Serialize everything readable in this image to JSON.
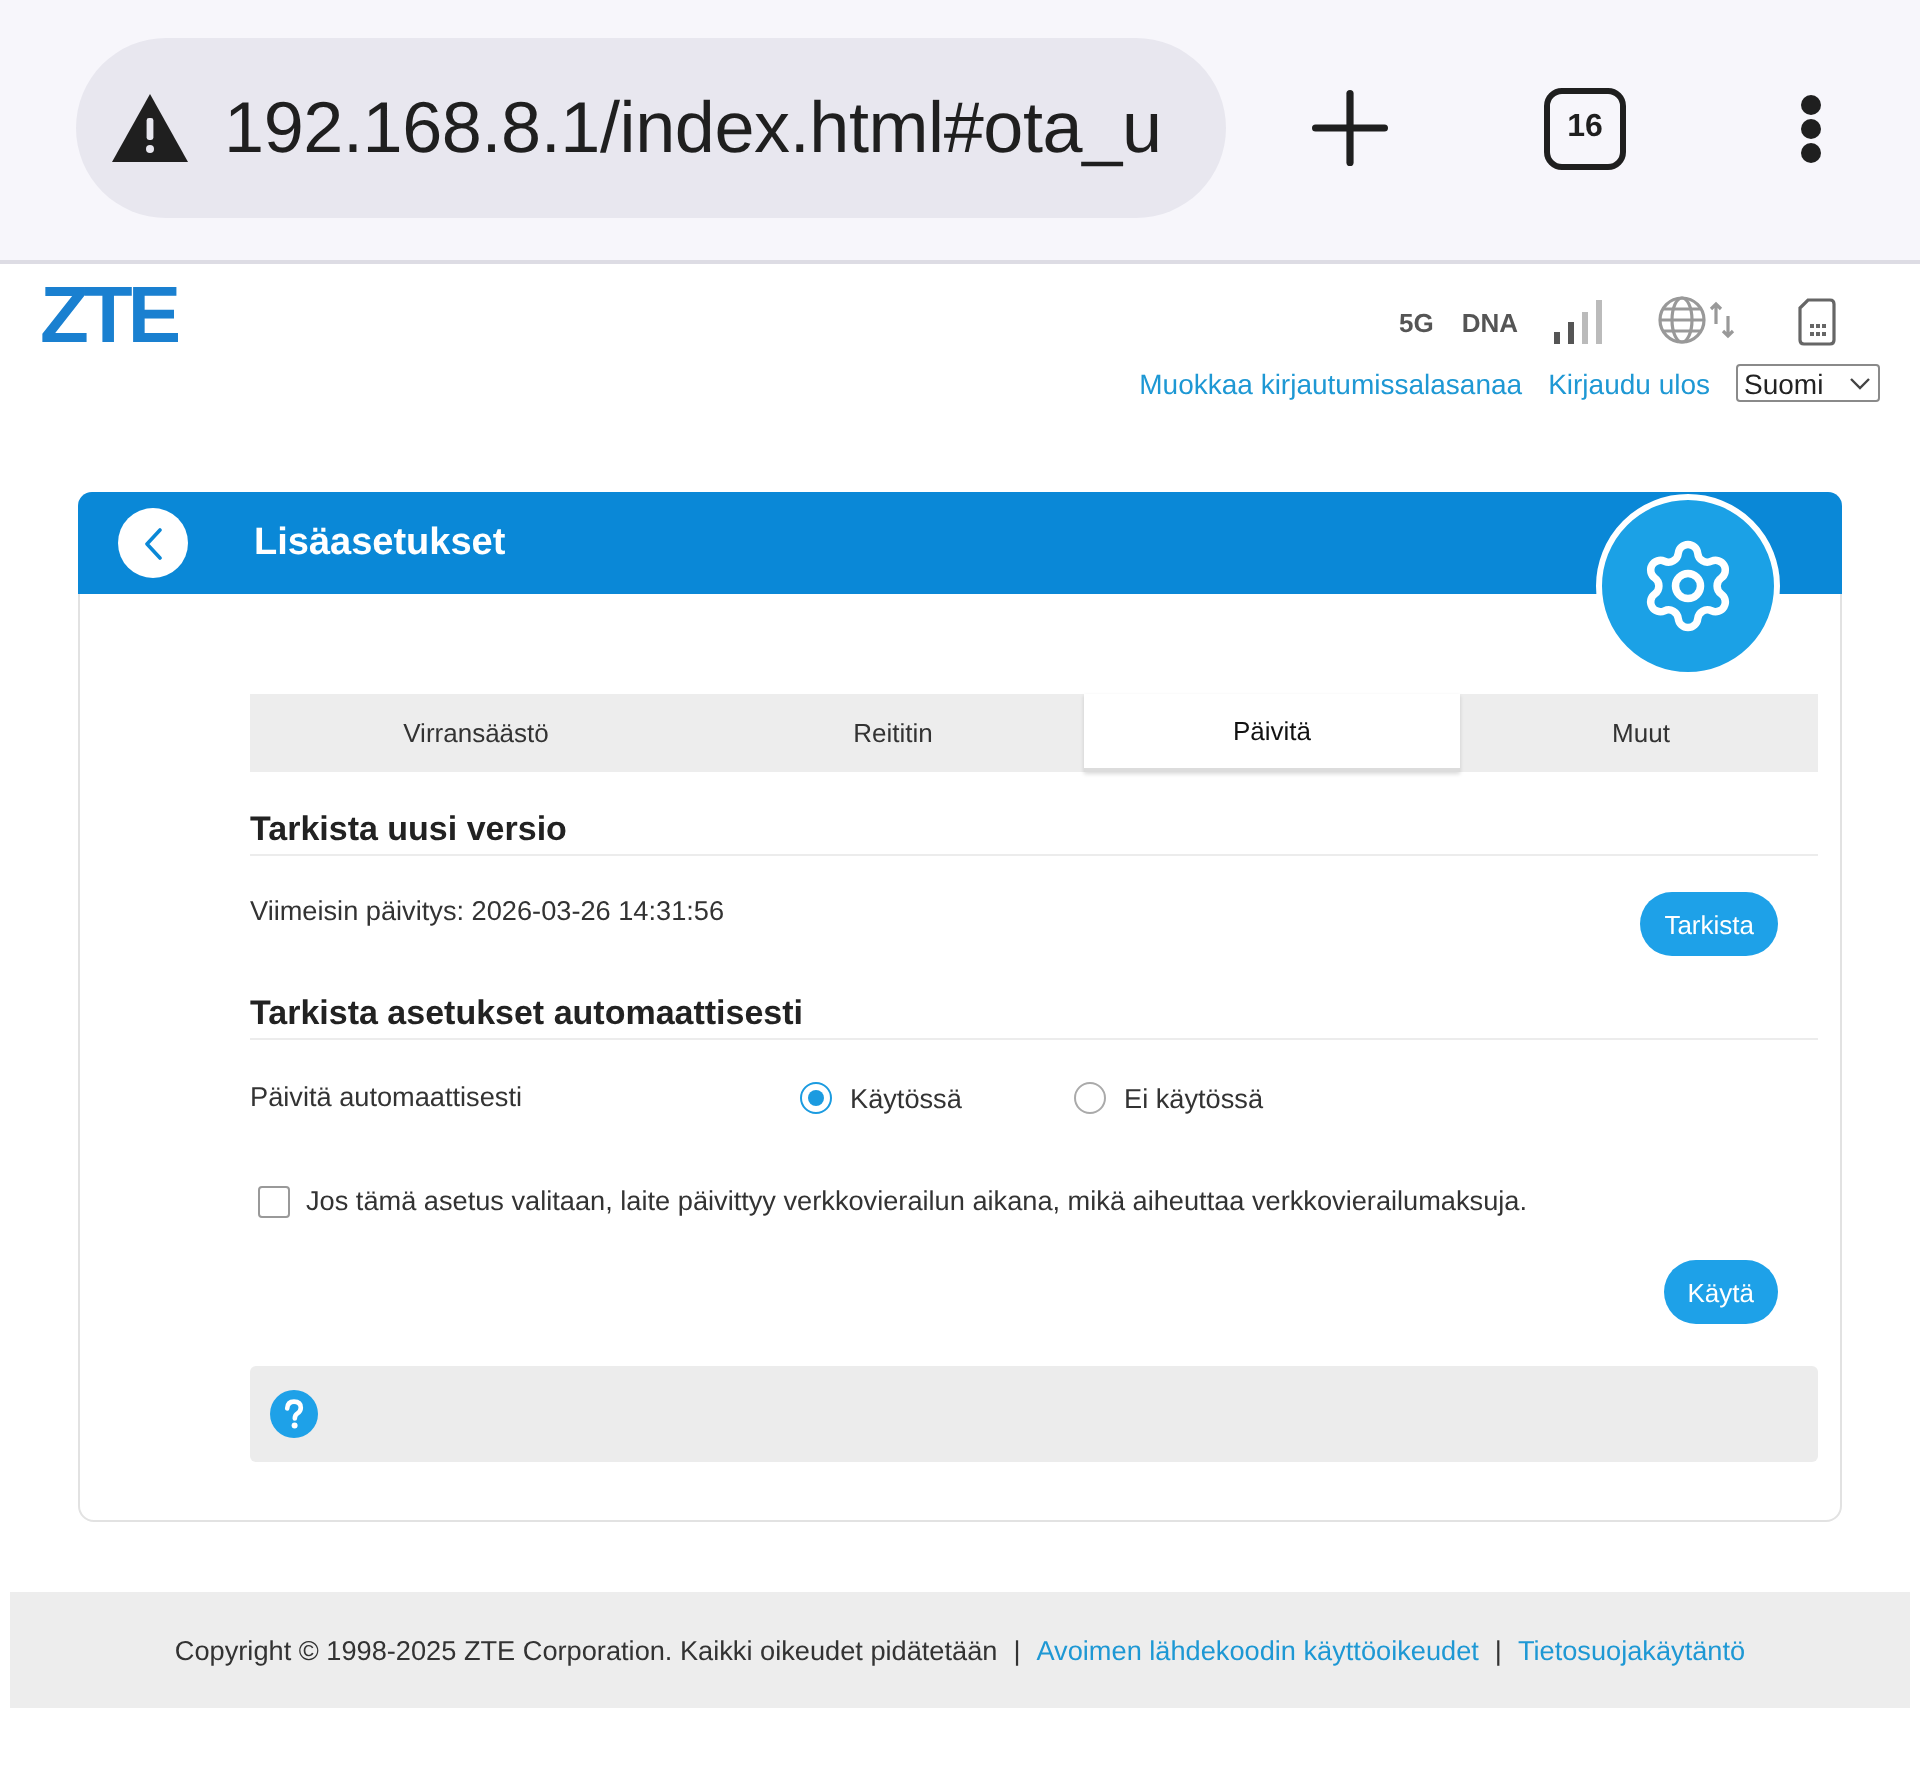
{
  "browser": {
    "url": "192.168.8.1/index.html#ota_u",
    "tab_count": "16"
  },
  "header": {
    "logo": "ZTE",
    "status": [
      {
        "kind": "label",
        "text": "5G"
      },
      {
        "kind": "label",
        "text": "DNA"
      },
      {
        "kind": "signal"
      },
      {
        "kind": "internet"
      },
      {
        "kind": "sim"
      }
    ],
    "links": [
      "Muokkaa kirjautumissalasanaa",
      "Kirjaudu ulos"
    ],
    "language": "Suomi"
  },
  "panel": {
    "title": "Lisäasetukset",
    "tabs": [
      {
        "label": "Virransäästö",
        "selected": false
      },
      {
        "label": "Reititin",
        "selected": false
      },
      {
        "label": "Päivitä",
        "selected": true
      },
      {
        "label": "Muut",
        "selected": false
      }
    ],
    "sections": [
      {
        "heading": "Tarkista uusi versio",
        "rows": [
          {
            "kind": "info",
            "text": "Viimeisin päivitys: 2026-03-26 14:31:56",
            "button": "Tarkista"
          }
        ]
      },
      {
        "heading": "Tarkista asetukset automaattisesti",
        "rows": [
          {
            "kind": "radio",
            "label": "Päivitä automaattisesti",
            "options": [
              {
                "label": "Käytössä",
                "selected": true
              },
              {
                "label": "Ei käytössä",
                "selected": false
              }
            ]
          },
          {
            "kind": "checkbox",
            "label": "Jos tämä asetus valitaan, laite päivittyy verkkovierailun aikana, mikä aiheuttaa verkkovierailumaksuja.",
            "checked": false
          }
        ]
      }
    ],
    "apply_button": "Käytä"
  },
  "footer": {
    "items": [
      {
        "kind": "text",
        "text": "Copyright © 1998-2025 ZTE Corporation. Kaikki oikeudet pidätetään"
      },
      {
        "kind": "separator",
        "text": "|"
      },
      {
        "kind": "link",
        "text": "Avoimen lähdekoodin käyttöoikeudet"
      },
      {
        "kind": "separator",
        "text": "|"
      },
      {
        "kind": "link",
        "text": "Tietosuojakäytäntö"
      }
    ]
  }
}
